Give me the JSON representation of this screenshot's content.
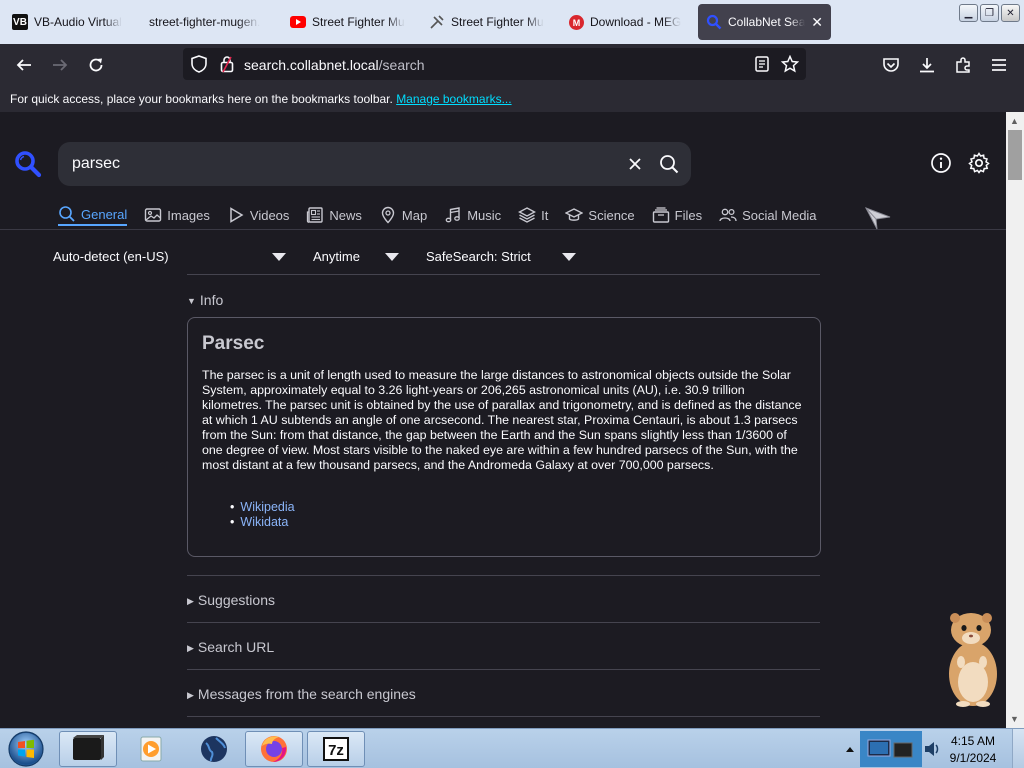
{
  "tabs": [
    {
      "label": "VB-Audio Virtual",
      "icon": "vb-icon",
      "icon_text": "VB"
    },
    {
      "label": "street-fighter-mugen.",
      "icon": "none"
    },
    {
      "label": "Street Fighter Mu",
      "icon": "youtube-icon"
    },
    {
      "label": "Street Fighter Mu",
      "icon": "game-icon"
    },
    {
      "label": "Download - MEG",
      "icon": "mega-icon"
    },
    {
      "label": "CollabNet Sear",
      "icon": "search-icon",
      "active": true
    }
  ],
  "url": {
    "domain": "search.collabnet.local",
    "path": "/search"
  },
  "bookmarks_bar": {
    "text": "For quick access, place your bookmarks here on the bookmarks toolbar. ",
    "link": "Manage bookmarks..."
  },
  "search": {
    "query": "parsec"
  },
  "categories": [
    {
      "label": "General",
      "icon": "search-icon",
      "active": true
    },
    {
      "label": "Images",
      "icon": "image-icon"
    },
    {
      "label": "Videos",
      "icon": "play-icon"
    },
    {
      "label": "News",
      "icon": "newspaper-icon"
    },
    {
      "label": "Map",
      "icon": "map-pin-icon"
    },
    {
      "label": "Music",
      "icon": "music-icon"
    },
    {
      "label": "It",
      "icon": "layers-icon"
    },
    {
      "label": "Science",
      "icon": "graduation-cap-icon"
    },
    {
      "label": "Files",
      "icon": "files-icon"
    },
    {
      "label": "Social Media",
      "icon": "users-icon"
    }
  ],
  "filters": {
    "language": "Auto-detect (en-US)",
    "time": "Anytime",
    "safesearch": "SafeSearch: Strict"
  },
  "info": {
    "heading": "Info",
    "title": "Parsec",
    "text": "The parsec is a unit of length used to measure the large distances to astronomical objects outside the Solar System, approximately equal to 3.26 light-years or 206,265 astronomical units (AU), i.e. 30.9 trillion kilometres. The parsec unit is obtained by the use of parallax and trigonometry, and is defined as the distance at which 1 AU subtends an angle of one arcsecond. The nearest star, Proxima Centauri, is about 1.3 parsecs from the Sun: from that distance, the gap between the Earth and the Sun spans slightly less than 1/3600 of one degree of view. Most stars visible to the naked eye are within a few hundred parsecs of the Sun, with the most distant at a few thousand parsecs, and the Andromeda Galaxy at over 700,000 parsecs.",
    "links": [
      "Wikipedia",
      "Wikidata"
    ]
  },
  "sections": [
    "Suggestions",
    "Search URL",
    "Messages from the search engines"
  ],
  "clock": {
    "time": "4:15 AM",
    "date": "9/1/2024"
  },
  "colors": {
    "accent": "#58a6ff",
    "page_bg": "#1c1b22",
    "logo_blue": "#3050ff"
  }
}
